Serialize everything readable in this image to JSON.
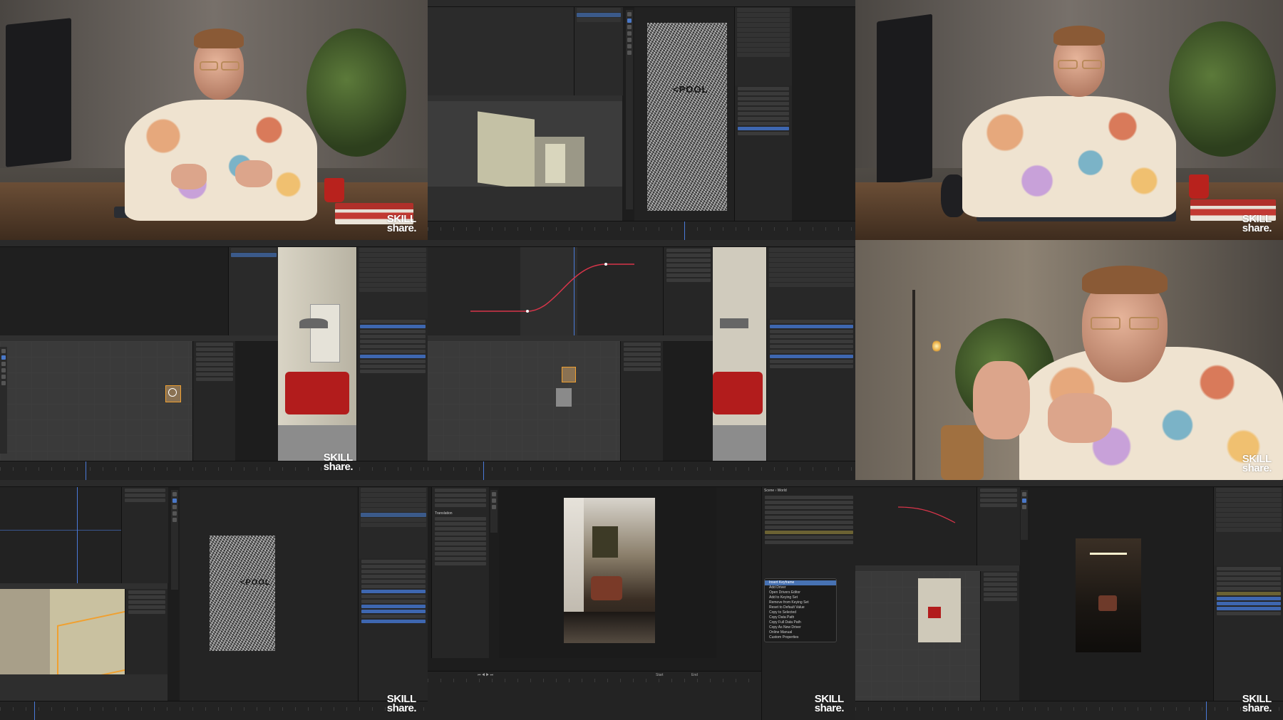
{
  "page": {
    "layout": "3x3 grid of course preview stills"
  },
  "brand": {
    "watermark_line1": "SKILL",
    "watermark_line2": "share."
  },
  "colors": {
    "blender_bg": "#1d1d1d",
    "selection_blue": "#4772b3",
    "curve_red": "#d8354a",
    "mug_red": "#b8221d"
  },
  "cell2": {
    "door_sign": "<POOL"
  },
  "cell6": {
    "door_sign": "<PO"
  },
  "cell7": {
    "door_sign": "<POOL"
  },
  "cell8": {
    "panel_title": "Translation",
    "tabs": [
      "Scene",
      "World"
    ],
    "context_menu": {
      "items": [
        "Insert Keyframe",
        "Add Driver",
        "Open Drivers Editor",
        "Add to Keying Set",
        "Remove from Keying Set",
        "Reset to Default Value",
        "Copy to Selected",
        "Copy Data Path",
        "Copy Full Data Path",
        "Copy As New Driver",
        "Online Manual",
        "Custom Properties"
      ],
      "highlighted_index": 0
    },
    "playback": {
      "start_label": "Start",
      "end_label": "End"
    }
  },
  "timeline": {
    "playhead_positions": [
      0.6,
      0.2,
      0.13,
      0.08,
      0.82
    ]
  }
}
